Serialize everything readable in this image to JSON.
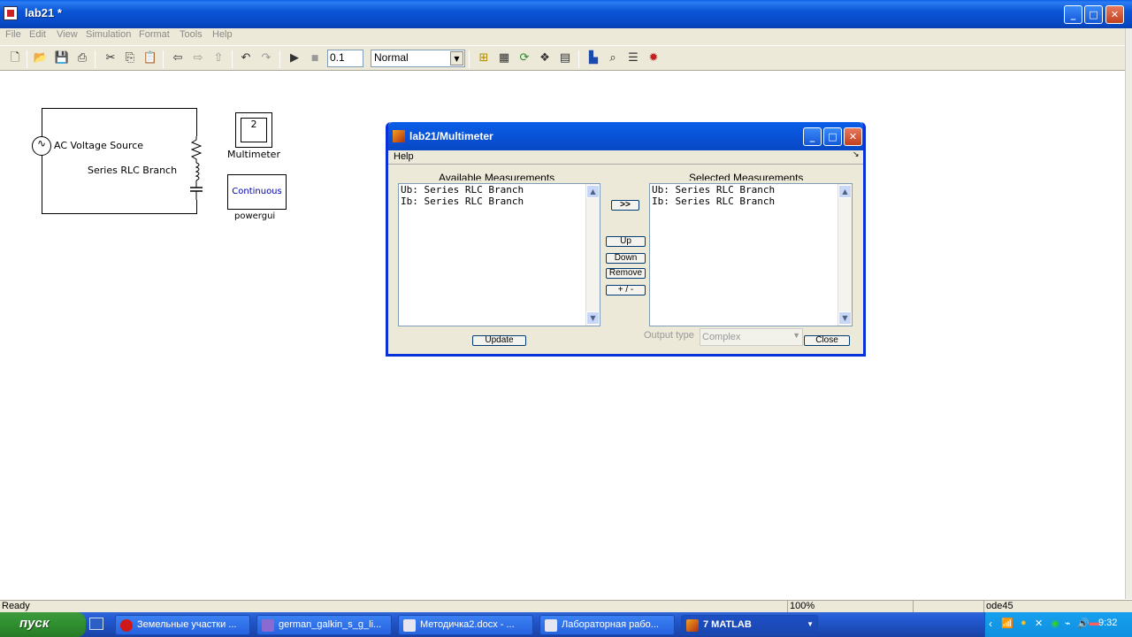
{
  "window": {
    "title": "lab21 *",
    "min": "_",
    "max": "□",
    "close": "✕"
  },
  "menu": [
    "File",
    "Edit",
    "View",
    "Simulation",
    "Format",
    "Tools",
    "Help"
  ],
  "toolbar": {
    "stop_time": "0.1",
    "sim_mode": "Normal"
  },
  "model": {
    "source_label": "AC Voltage Source",
    "rlc_label": "Series RLC Branch",
    "multimeter_value": "2",
    "multimeter_label": "Multimeter",
    "powergui_block": "Continuous",
    "powergui_label": "powergui"
  },
  "dialog": {
    "title": "lab21/Multimeter",
    "menu_help": "Help",
    "available_title": "Available Measurements",
    "selected_title": "Selected Measurements",
    "available": [
      "Ub: Series RLC Branch",
      "Ib: Series RLC Branch"
    ],
    "selected": [
      "Ub: Series RLC Branch",
      "Ib: Series RLC Branch"
    ],
    "add_btn": ">>",
    "up_btn": "Up",
    "down_btn": "Down",
    "remove_btn": "Remove",
    "sign_btn": "+ / -",
    "update_btn": "Update",
    "output_type_label": "Output type",
    "output_type_value": "Complex",
    "close_btn": "Close"
  },
  "status": {
    "text": "Ready",
    "zoom": "100%",
    "solver": "ode45"
  },
  "taskbar": {
    "start": "пуск",
    "tasks": [
      "Земельные участки ...",
      "german_galkin_s_g_li...",
      "Методичка2.docx - ...",
      "Лабораторная рабо...",
      "7 MATLAB"
    ],
    "clock": "9:32"
  }
}
